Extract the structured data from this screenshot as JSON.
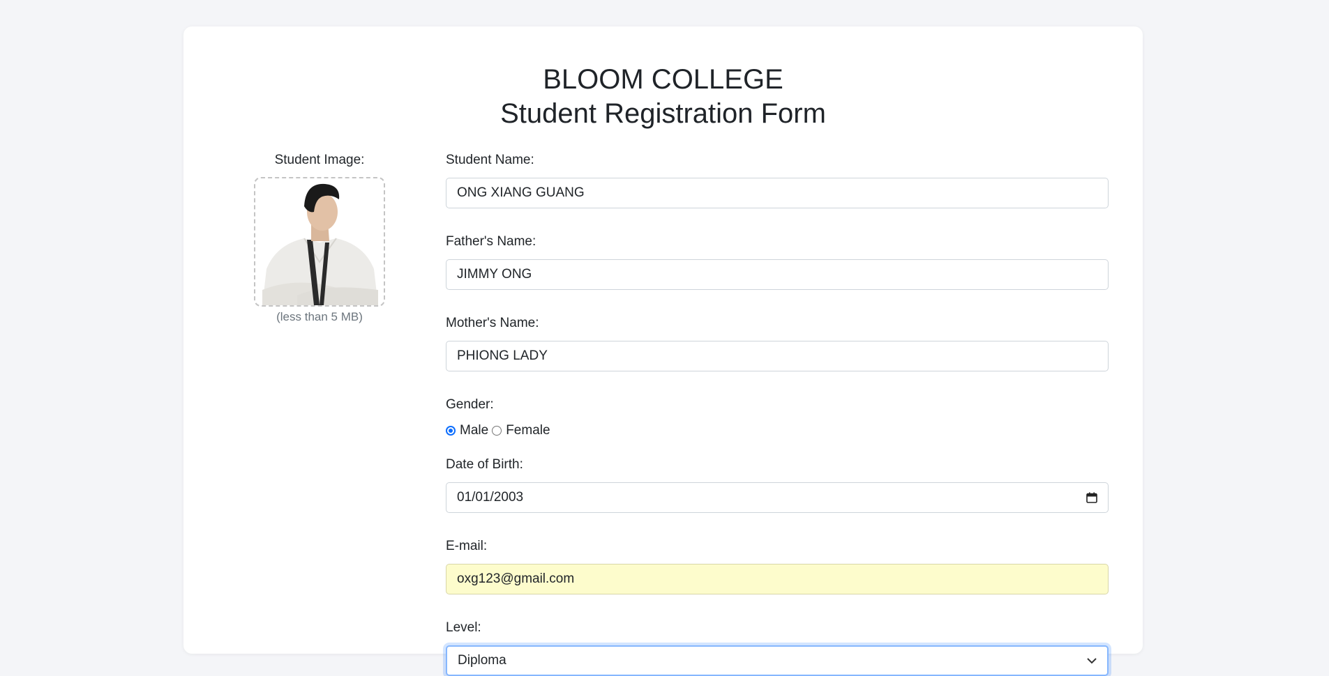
{
  "header": {
    "college": "BLOOM COLLEGE",
    "form_title": "Student Registration Form"
  },
  "image_section": {
    "label": "Student Image:",
    "note": "(less than 5 MB)"
  },
  "form": {
    "student_name_label": "Student Name:",
    "student_name_value": "ONG XIANG GUANG",
    "father_name_label": "Father's Name:",
    "father_name_value": "JIMMY ONG",
    "mother_name_label": "Mother's Name:",
    "mother_name_value": "PHIONG LADY",
    "gender_label": "Gender:",
    "gender_options": [
      "Male",
      "Female"
    ],
    "gender_selected": "Male",
    "dob_label": "Date of Birth:",
    "dob_value": "01/01/2003",
    "email_label": "E-mail:",
    "email_value": "oxg123@gmail.com",
    "level_label": "Level:",
    "level_value": "Diploma"
  },
  "colors": {
    "accent": "#0d6efd",
    "autofill": "#fdfccc",
    "background": "#f4f5f8"
  },
  "icons": [
    "calendar-icon",
    "chevron-down-icon"
  ]
}
